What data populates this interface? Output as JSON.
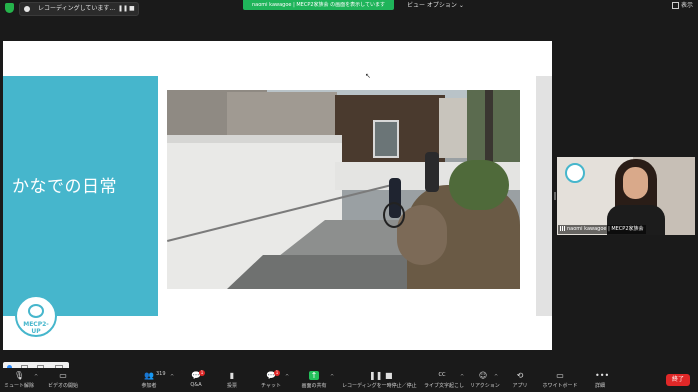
{
  "top_bar": {
    "recording_text": "レコーディングしています...",
    "pause_icon": "pause-icon",
    "stop_icon": "stop-icon",
    "share_banner": "naomi kawagoe | MECP2家族会 の画面を表示しています",
    "view_options": "ビュー オプション ⌄",
    "display": "表示"
  },
  "slide": {
    "title": "かなでの日常",
    "logo_text": "MECP2-UP",
    "accent_color": "#46b6cc"
  },
  "participant": {
    "name": "naomi kawagoe | MECP2家族会"
  },
  "toolbar": {
    "items": [
      {
        "label": "ミュート解除",
        "icon": "microphone-muted-icon"
      },
      {
        "label": "ビデオの開始",
        "icon": "video-off-icon"
      },
      {
        "label": "参加者",
        "icon": "participants-icon",
        "count": "319"
      },
      {
        "label": "Q&A",
        "icon": "qa-icon",
        "badge": "1"
      },
      {
        "label": "投票",
        "icon": "poll-icon"
      },
      {
        "label": "チャット",
        "icon": "chat-icon",
        "badge": "1"
      },
      {
        "label": "画面の共有",
        "icon": "share-screen-icon"
      },
      {
        "label": "レコーディングを一時停止／停止",
        "icon": "recording-icon"
      },
      {
        "label": "ライブ文字起こし",
        "icon": "cc-icon"
      },
      {
        "label": "リアクション",
        "icon": "reaction-icon"
      },
      {
        "label": "アプリ",
        "icon": "apps-icon"
      },
      {
        "label": "ホワイトボード",
        "icon": "whiteboard-icon"
      },
      {
        "label": "詳細",
        "icon": "more-icon"
      }
    ],
    "end": "終了",
    "share_color": "#23c05a",
    "end_color": "#e02828"
  }
}
